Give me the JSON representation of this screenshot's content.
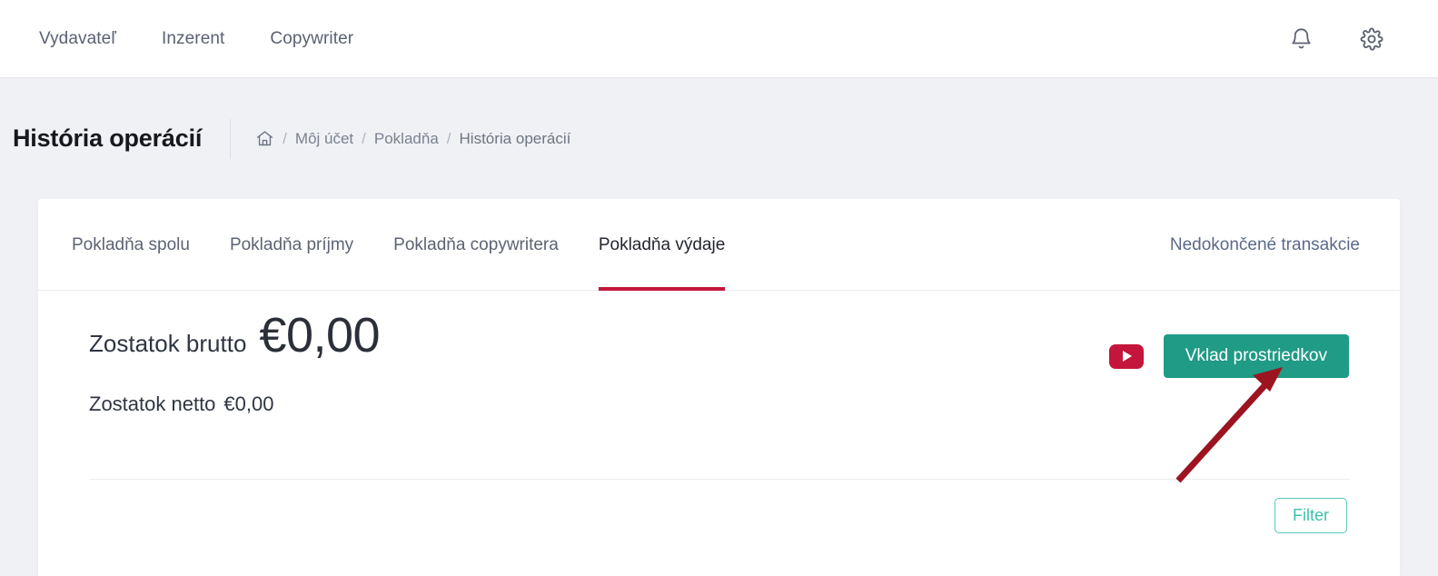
{
  "topnav": {
    "links": [
      {
        "label": "Vydavateľ"
      },
      {
        "label": "Inzerent"
      },
      {
        "label": "Copywriter"
      }
    ],
    "notifications_icon": "bell-icon",
    "settings_icon": "gear-icon"
  },
  "header": {
    "title": "História operácií",
    "breadcrumb": {
      "home_icon": "home-icon",
      "separator": "/",
      "items": [
        {
          "label": "Môj účet"
        },
        {
          "label": "Pokladňa"
        },
        {
          "label": "História operácií"
        }
      ]
    }
  },
  "tabs": {
    "items": [
      {
        "label": "Pokladňa spolu",
        "active": false
      },
      {
        "label": "Pokladňa príjmy",
        "active": false
      },
      {
        "label": "Pokladňa copywritera",
        "active": false
      },
      {
        "label": "Pokladňa výdaje",
        "active": true
      }
    ],
    "right_link": "Nedokončené transakcie",
    "active_underline_color": "#c4163c"
  },
  "balance": {
    "gross_label": "Zostatok brutto",
    "gross_amount": "€0,00",
    "net_label": "Zostatok netto",
    "net_amount": "€0,00",
    "video_icon": "youtube-play-icon",
    "deposit_button": "Vklad prostriedkov",
    "deposit_button_color": "#1f9b86"
  },
  "toolbar": {
    "filter_button": "Filter",
    "filter_accent_color": "#3fc0ae"
  },
  "annotation": {
    "arrow_color": "#9c1420",
    "points_to": "Vklad prostriedkov"
  }
}
